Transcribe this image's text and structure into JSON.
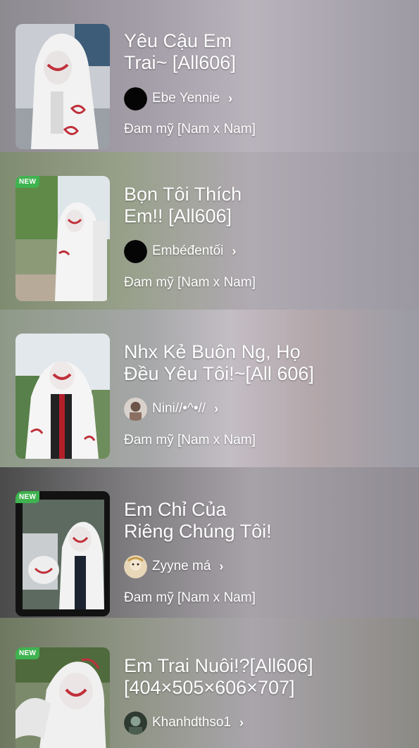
{
  "stories": [
    {
      "title_line1": "Yêu Cậu Em",
      "title_line2": "Trai~ [All606]",
      "author": "Ebe Yennie",
      "genre": "Đam mỹ [Nam x Nam]",
      "is_new": false,
      "new_label": ""
    },
    {
      "title_line1": "Bọn Tôi Thích",
      "title_line2": "Em!! [All606]",
      "author": "Embéđentối",
      "genre": "Đam mỹ [Nam x Nam]",
      "is_new": true,
      "new_label": "NEW"
    },
    {
      "title_line1": "Nhx Kẻ Buôn Ng, Họ",
      "title_line2": "Đều Yêu Tôi!~[All 606]",
      "author": "Nini//•^•//",
      "genre": "Đam mỹ [Nam x Nam]",
      "is_new": false,
      "new_label": ""
    },
    {
      "title_line1": "Em Chỉ Của",
      "title_line2": "Riêng Chúng Tôi!",
      "author": "Zyyne má",
      "genre": "Đam mỹ [Nam x Nam]",
      "is_new": true,
      "new_label": "NEW"
    },
    {
      "title_line1": "Em Trai Nuôi!?[All606]",
      "title_line2": "[404×505×606×707]",
      "author": "Khanhdthso1",
      "genre": "",
      "is_new": true,
      "new_label": "NEW"
    }
  ],
  "chevron_icon": "chevron-right-icon",
  "colors": {
    "new_badge": "#3fb34f",
    "text": "#ffffff"
  }
}
